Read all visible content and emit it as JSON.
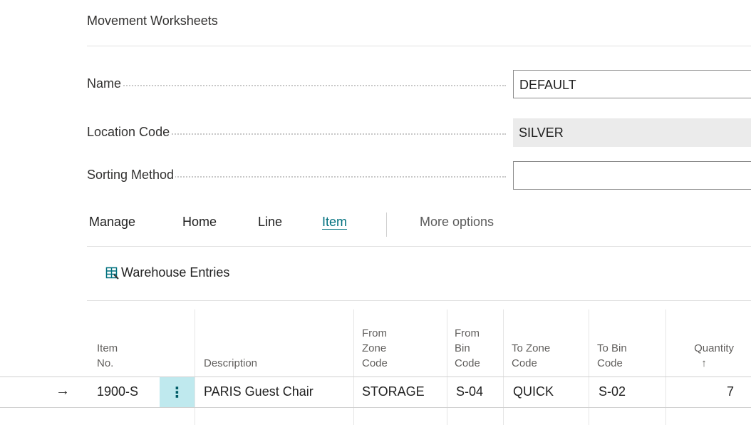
{
  "page": {
    "title": "Movement Worksheets"
  },
  "fields": {
    "name": {
      "label": "Name",
      "value": "DEFAULT"
    },
    "location_code": {
      "label": "Location Code",
      "value": "SILVER"
    },
    "sorting_method": {
      "label": "Sorting Method",
      "value": ""
    }
  },
  "actions": {
    "manage": "Manage",
    "home": "Home",
    "line": "Line",
    "item": "Item",
    "more": "More options"
  },
  "sub_actions": {
    "warehouse_entries": "Warehouse Entries",
    "warehouse_entries_icon": "ledger-entries-icon"
  },
  "table": {
    "headers": {
      "item_no": [
        "Item",
        "No."
      ],
      "description": [
        "Description"
      ],
      "from_zone": [
        "From",
        "Zone",
        "Code"
      ],
      "from_bin": [
        "From",
        "Bin",
        "Code"
      ],
      "to_zone": [
        "To Zone",
        "Code"
      ],
      "to_bin": [
        "To Bin",
        "Code"
      ],
      "quantity": [
        "Quantity",
        "↑"
      ]
    },
    "rows": [
      {
        "indicator": "→",
        "item_no": "1900-S",
        "menu": "⋮",
        "description": "PARIS Guest Chair",
        "from_zone": "STORAGE",
        "from_bin": "S-04",
        "to_zone": "QUICK",
        "to_bin": "S-02",
        "quantity": "7"
      }
    ]
  },
  "colors": {
    "accent": "#00707e",
    "selected_cell": "#bfe9ee",
    "readonly_field": "#ebebeb"
  }
}
